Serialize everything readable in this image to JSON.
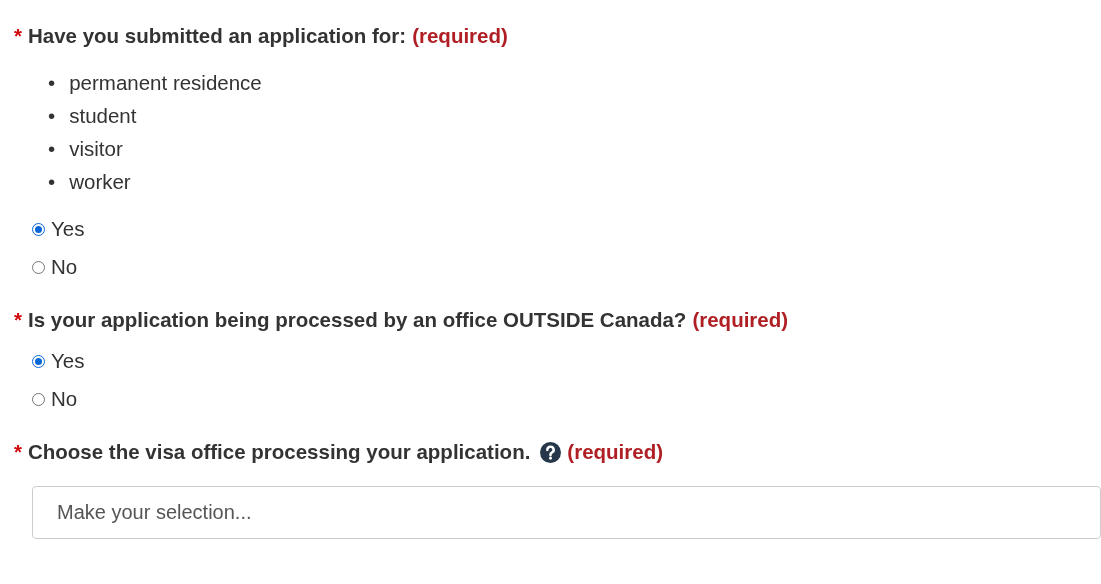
{
  "questions": [
    {
      "mark": "*",
      "label": "Have you submitted an application for:",
      "required": "(required)",
      "help_icon": false,
      "list": [
        {
          "marker": "•",
          "text": "permanent residence"
        },
        {
          "marker": "•",
          "text": "student"
        },
        {
          "marker": "•",
          "text": "visitor"
        },
        {
          "marker": "•",
          "text": "worker"
        }
      ],
      "options": [
        {
          "label": "Yes",
          "selected": true
        },
        {
          "label": "No",
          "selected": false
        }
      ]
    },
    {
      "mark": "*",
      "label": "Is your application being processed by an office OUTSIDE Canada?",
      "required": "(required)",
      "help_icon": false,
      "options": [
        {
          "label": "Yes",
          "selected": true
        },
        {
          "label": "No",
          "selected": false
        }
      ]
    },
    {
      "mark": "*",
      "label": "Choose the visa office processing your application.",
      "required": "(required)",
      "help_icon": true,
      "select": {
        "placeholder": "Make your selection..."
      }
    }
  ]
}
